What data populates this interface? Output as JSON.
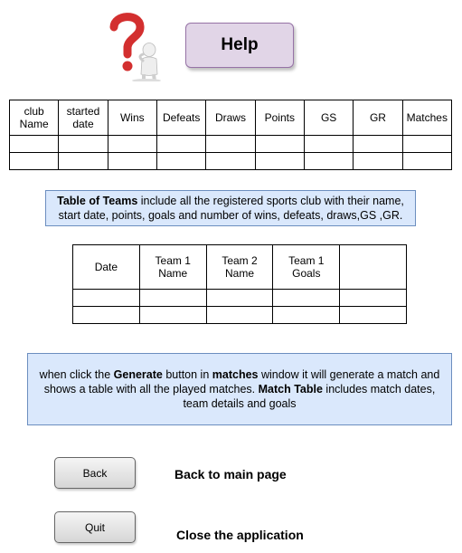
{
  "header": {
    "title": "Help"
  },
  "teams_table": {
    "columns": [
      [
        "club",
        "Name"
      ],
      [
        "started",
        "date"
      ],
      [
        "Wins"
      ],
      [
        "Defeats"
      ],
      [
        "Draws"
      ],
      [
        "Points"
      ],
      [
        "GS"
      ],
      [
        "GR"
      ],
      [
        "Matches"
      ]
    ],
    "empty_rows": 2
  },
  "teams_info": {
    "bold_label": "Table of Teams",
    "text": " include all the registered sports club with their name, start date, points, goals and number of wins, defeats, draws,GS ,GR."
  },
  "matches_table": {
    "columns": [
      [
        "Date"
      ],
      [
        "Team 1",
        "Name"
      ],
      [
        "Team 2",
        "Name"
      ],
      [
        "Team 1",
        "Goals"
      ],
      [
        ""
      ]
    ],
    "empty_rows": 2
  },
  "matches_info": {
    "part1": "when click the ",
    "bold1": "Generate",
    "part2": " button in ",
    "bold2": "matches",
    "part3": " window it will generate a match and shows a table with all the played matches. ",
    "bold3": "Match Table",
    "part4": " includes match dates, team details and goals"
  },
  "buttons": {
    "back_label": "Back",
    "back_description": "Back to main page",
    "quit_label": "Quit",
    "quit_description": "Close the application"
  },
  "colors": {
    "help_fill": "#e1d5e7",
    "info_fill": "#dae8fc",
    "question_mark": "#d32f2f"
  },
  "icons": {
    "help_figure": "question-mark-person-icon"
  }
}
